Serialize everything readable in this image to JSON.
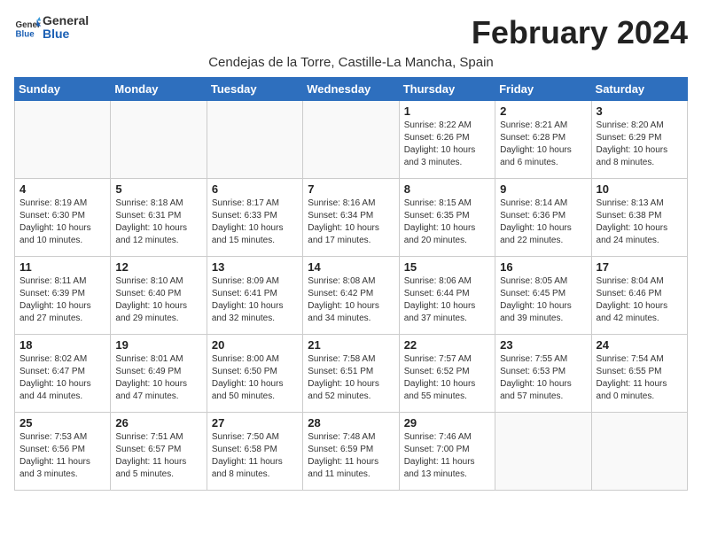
{
  "logo": {
    "general": "General",
    "blue": "Blue"
  },
  "title": "February 2024",
  "location": "Cendejas de la Torre, Castille-La Mancha, Spain",
  "weekdays": [
    "Sunday",
    "Monday",
    "Tuesday",
    "Wednesday",
    "Thursday",
    "Friday",
    "Saturday"
  ],
  "weeks": [
    [
      {
        "day": "",
        "info": ""
      },
      {
        "day": "",
        "info": ""
      },
      {
        "day": "",
        "info": ""
      },
      {
        "day": "",
        "info": ""
      },
      {
        "day": "1",
        "info": "Sunrise: 8:22 AM\nSunset: 6:26 PM\nDaylight: 10 hours\nand 3 minutes."
      },
      {
        "day": "2",
        "info": "Sunrise: 8:21 AM\nSunset: 6:28 PM\nDaylight: 10 hours\nand 6 minutes."
      },
      {
        "day": "3",
        "info": "Sunrise: 8:20 AM\nSunset: 6:29 PM\nDaylight: 10 hours\nand 8 minutes."
      }
    ],
    [
      {
        "day": "4",
        "info": "Sunrise: 8:19 AM\nSunset: 6:30 PM\nDaylight: 10 hours\nand 10 minutes."
      },
      {
        "day": "5",
        "info": "Sunrise: 8:18 AM\nSunset: 6:31 PM\nDaylight: 10 hours\nand 12 minutes."
      },
      {
        "day": "6",
        "info": "Sunrise: 8:17 AM\nSunset: 6:33 PM\nDaylight: 10 hours\nand 15 minutes."
      },
      {
        "day": "7",
        "info": "Sunrise: 8:16 AM\nSunset: 6:34 PM\nDaylight: 10 hours\nand 17 minutes."
      },
      {
        "day": "8",
        "info": "Sunrise: 8:15 AM\nSunset: 6:35 PM\nDaylight: 10 hours\nand 20 minutes."
      },
      {
        "day": "9",
        "info": "Sunrise: 8:14 AM\nSunset: 6:36 PM\nDaylight: 10 hours\nand 22 minutes."
      },
      {
        "day": "10",
        "info": "Sunrise: 8:13 AM\nSunset: 6:38 PM\nDaylight: 10 hours\nand 24 minutes."
      }
    ],
    [
      {
        "day": "11",
        "info": "Sunrise: 8:11 AM\nSunset: 6:39 PM\nDaylight: 10 hours\nand 27 minutes."
      },
      {
        "day": "12",
        "info": "Sunrise: 8:10 AM\nSunset: 6:40 PM\nDaylight: 10 hours\nand 29 minutes."
      },
      {
        "day": "13",
        "info": "Sunrise: 8:09 AM\nSunset: 6:41 PM\nDaylight: 10 hours\nand 32 minutes."
      },
      {
        "day": "14",
        "info": "Sunrise: 8:08 AM\nSunset: 6:42 PM\nDaylight: 10 hours\nand 34 minutes."
      },
      {
        "day": "15",
        "info": "Sunrise: 8:06 AM\nSunset: 6:44 PM\nDaylight: 10 hours\nand 37 minutes."
      },
      {
        "day": "16",
        "info": "Sunrise: 8:05 AM\nSunset: 6:45 PM\nDaylight: 10 hours\nand 39 minutes."
      },
      {
        "day": "17",
        "info": "Sunrise: 8:04 AM\nSunset: 6:46 PM\nDaylight: 10 hours\nand 42 minutes."
      }
    ],
    [
      {
        "day": "18",
        "info": "Sunrise: 8:02 AM\nSunset: 6:47 PM\nDaylight: 10 hours\nand 44 minutes."
      },
      {
        "day": "19",
        "info": "Sunrise: 8:01 AM\nSunset: 6:49 PM\nDaylight: 10 hours\nand 47 minutes."
      },
      {
        "day": "20",
        "info": "Sunrise: 8:00 AM\nSunset: 6:50 PM\nDaylight: 10 hours\nand 50 minutes."
      },
      {
        "day": "21",
        "info": "Sunrise: 7:58 AM\nSunset: 6:51 PM\nDaylight: 10 hours\nand 52 minutes."
      },
      {
        "day": "22",
        "info": "Sunrise: 7:57 AM\nSunset: 6:52 PM\nDaylight: 10 hours\nand 55 minutes."
      },
      {
        "day": "23",
        "info": "Sunrise: 7:55 AM\nSunset: 6:53 PM\nDaylight: 10 hours\nand 57 minutes."
      },
      {
        "day": "24",
        "info": "Sunrise: 7:54 AM\nSunset: 6:55 PM\nDaylight: 11 hours\nand 0 minutes."
      }
    ],
    [
      {
        "day": "25",
        "info": "Sunrise: 7:53 AM\nSunset: 6:56 PM\nDaylight: 11 hours\nand 3 minutes."
      },
      {
        "day": "26",
        "info": "Sunrise: 7:51 AM\nSunset: 6:57 PM\nDaylight: 11 hours\nand 5 minutes."
      },
      {
        "day": "27",
        "info": "Sunrise: 7:50 AM\nSunset: 6:58 PM\nDaylight: 11 hours\nand 8 minutes."
      },
      {
        "day": "28",
        "info": "Sunrise: 7:48 AM\nSunset: 6:59 PM\nDaylight: 11 hours\nand 11 minutes."
      },
      {
        "day": "29",
        "info": "Sunrise: 7:46 AM\nSunset: 7:00 PM\nDaylight: 11 hours\nand 13 minutes."
      },
      {
        "day": "",
        "info": ""
      },
      {
        "day": "",
        "info": ""
      }
    ]
  ]
}
